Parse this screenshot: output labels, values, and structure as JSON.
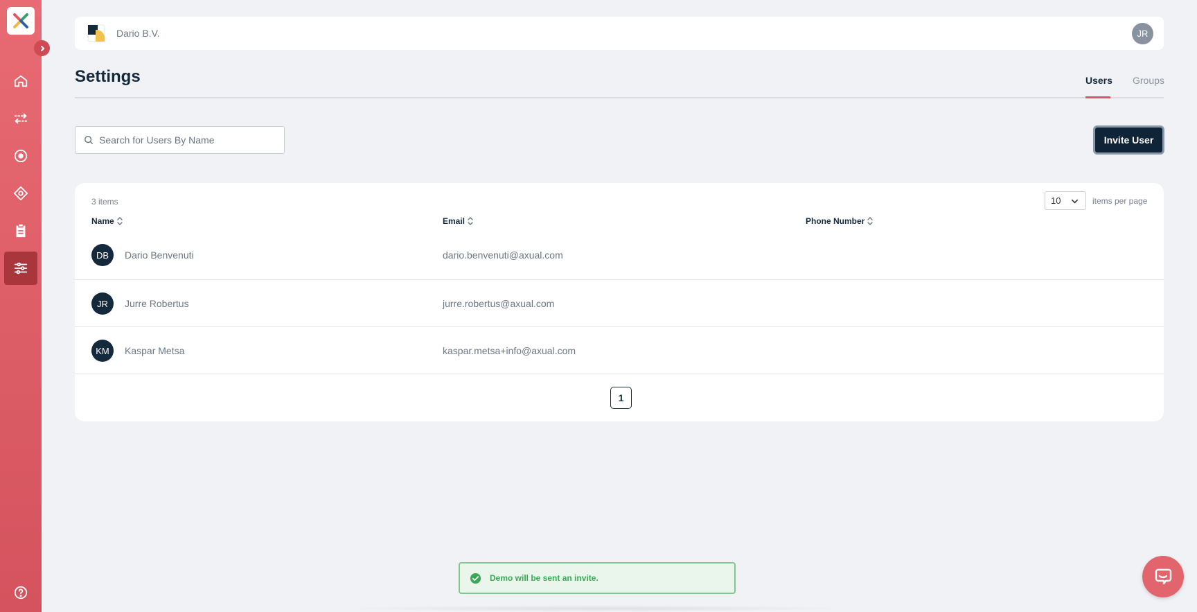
{
  "brand": {
    "accent": "#e0555f",
    "sidebar_color": "#d95b65",
    "primary": "#0f2537"
  },
  "sidebar": {
    "items": [
      {
        "name": "home",
        "icon": "home-icon"
      },
      {
        "name": "streams",
        "icon": "transfer-arrows-icon"
      },
      {
        "name": "apps",
        "icon": "target-icon"
      },
      {
        "name": "environments",
        "icon": "diamond-icon"
      },
      {
        "name": "clipboard",
        "icon": "clipboard-icon"
      },
      {
        "name": "settings",
        "icon": "sliders-icon",
        "active": true
      }
    ],
    "help_icon": "help-circle-icon"
  },
  "topbar": {
    "org_name": "Dario B.V.",
    "user_initials": "JR"
  },
  "page": {
    "title": "Settings",
    "tabs": [
      {
        "label": "Users",
        "active": true
      },
      {
        "label": "Groups",
        "active": false
      }
    ]
  },
  "search": {
    "placeholder": "Search for Users By Name",
    "value": ""
  },
  "toolbar": {
    "invite_label": "Invite User"
  },
  "table": {
    "items_count": "3 items",
    "per_page_value": "10",
    "per_page_label": "items per page",
    "columns": [
      "Name",
      "Email",
      "Phone Number"
    ],
    "rows": [
      {
        "initials": "DB",
        "name": "Dario Benvenuti",
        "email": "dario.benvenuti@axual.com",
        "phone": ""
      },
      {
        "initials": "JR",
        "name": "Jurre Robertus",
        "email": "jurre.robertus@axual.com",
        "phone": ""
      },
      {
        "initials": "KM",
        "name": "Kaspar Metsa",
        "email": "kaspar.metsa+info@axual.com",
        "phone": ""
      }
    ],
    "current_page": "1"
  },
  "toast": {
    "message": "Demo will be sent an invite.",
    "status_color": "#3aa955"
  }
}
